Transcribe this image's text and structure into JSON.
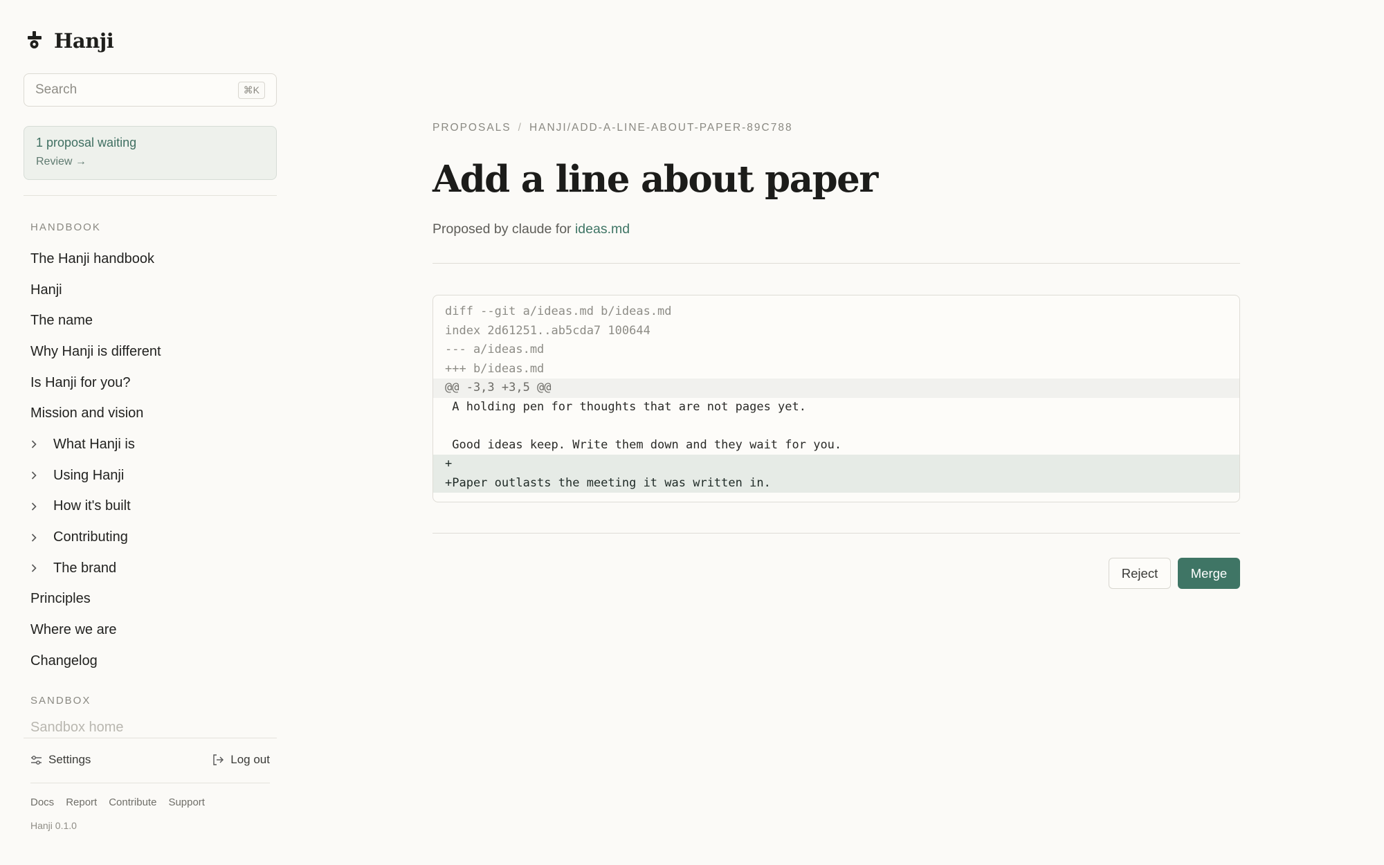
{
  "app": {
    "name": "Hanji",
    "version": "Hanji 0.1.0"
  },
  "search": {
    "placeholder": "Search",
    "shortcut": "⌘K"
  },
  "notice": {
    "title": "1 proposal waiting",
    "link": "Review →"
  },
  "sidebar": {
    "handbook_label": "HANDBOOK",
    "items": [
      {
        "label": "The Hanji handbook",
        "expandable": false
      },
      {
        "label": "Hanji",
        "expandable": false
      },
      {
        "label": "The name",
        "expandable": false
      },
      {
        "label": "Why Hanji is different",
        "expandable": false
      },
      {
        "label": "Is Hanji for you?",
        "expandable": false
      },
      {
        "label": "Mission and vision",
        "expandable": false
      },
      {
        "label": "What Hanji is",
        "expandable": true
      },
      {
        "label": "Using Hanji",
        "expandable": true
      },
      {
        "label": "How it's built",
        "expandable": true
      },
      {
        "label": "Contributing",
        "expandable": true
      },
      {
        "label": "The brand",
        "expandable": true
      },
      {
        "label": "Principles",
        "expandable": false
      },
      {
        "label": "Where we are",
        "expandable": false
      },
      {
        "label": "Changelog",
        "expandable": false
      }
    ],
    "sandbox_label": "SANDBOX",
    "sandbox_items": [
      {
        "label": "Sandbox home"
      }
    ],
    "settings_label": "Settings",
    "logout_label": "Log out",
    "footer_links": [
      "Docs",
      "Report",
      "Contribute",
      "Support"
    ]
  },
  "proposal": {
    "breadcrumb_root": "PROPOSALS",
    "breadcrumb_current": "HANJI/ADD-A-LINE-ABOUT-PAPER-89C788",
    "title": "Add a line about paper",
    "proposed_by_prefix": "Proposed by claude for",
    "file": "ideas.md",
    "diff": [
      {
        "kind": "meta",
        "text": "diff --git a/ideas.md b/ideas.md"
      },
      {
        "kind": "meta",
        "text": "index 2d61251..ab5cda7 100644"
      },
      {
        "kind": "meta",
        "text": "--- a/ideas.md"
      },
      {
        "kind": "meta",
        "text": "+++ b/ideas.md"
      },
      {
        "kind": "hunk",
        "text": "@@ -3,3 +3,5 @@"
      },
      {
        "kind": "ctx",
        "text": " A holding pen for thoughts that are not pages yet."
      },
      {
        "kind": "ctx",
        "text": ""
      },
      {
        "kind": "ctx",
        "text": " Good ideas keep. Write them down and they wait for you."
      },
      {
        "kind": "add",
        "text": "+"
      },
      {
        "kind": "add",
        "text": "+Paper outlasts the meeting it was written in."
      }
    ],
    "reject_label": "Reject",
    "merge_label": "Merge"
  },
  "colors": {
    "accent": "#3f7565",
    "background": "#fbfaf7"
  }
}
